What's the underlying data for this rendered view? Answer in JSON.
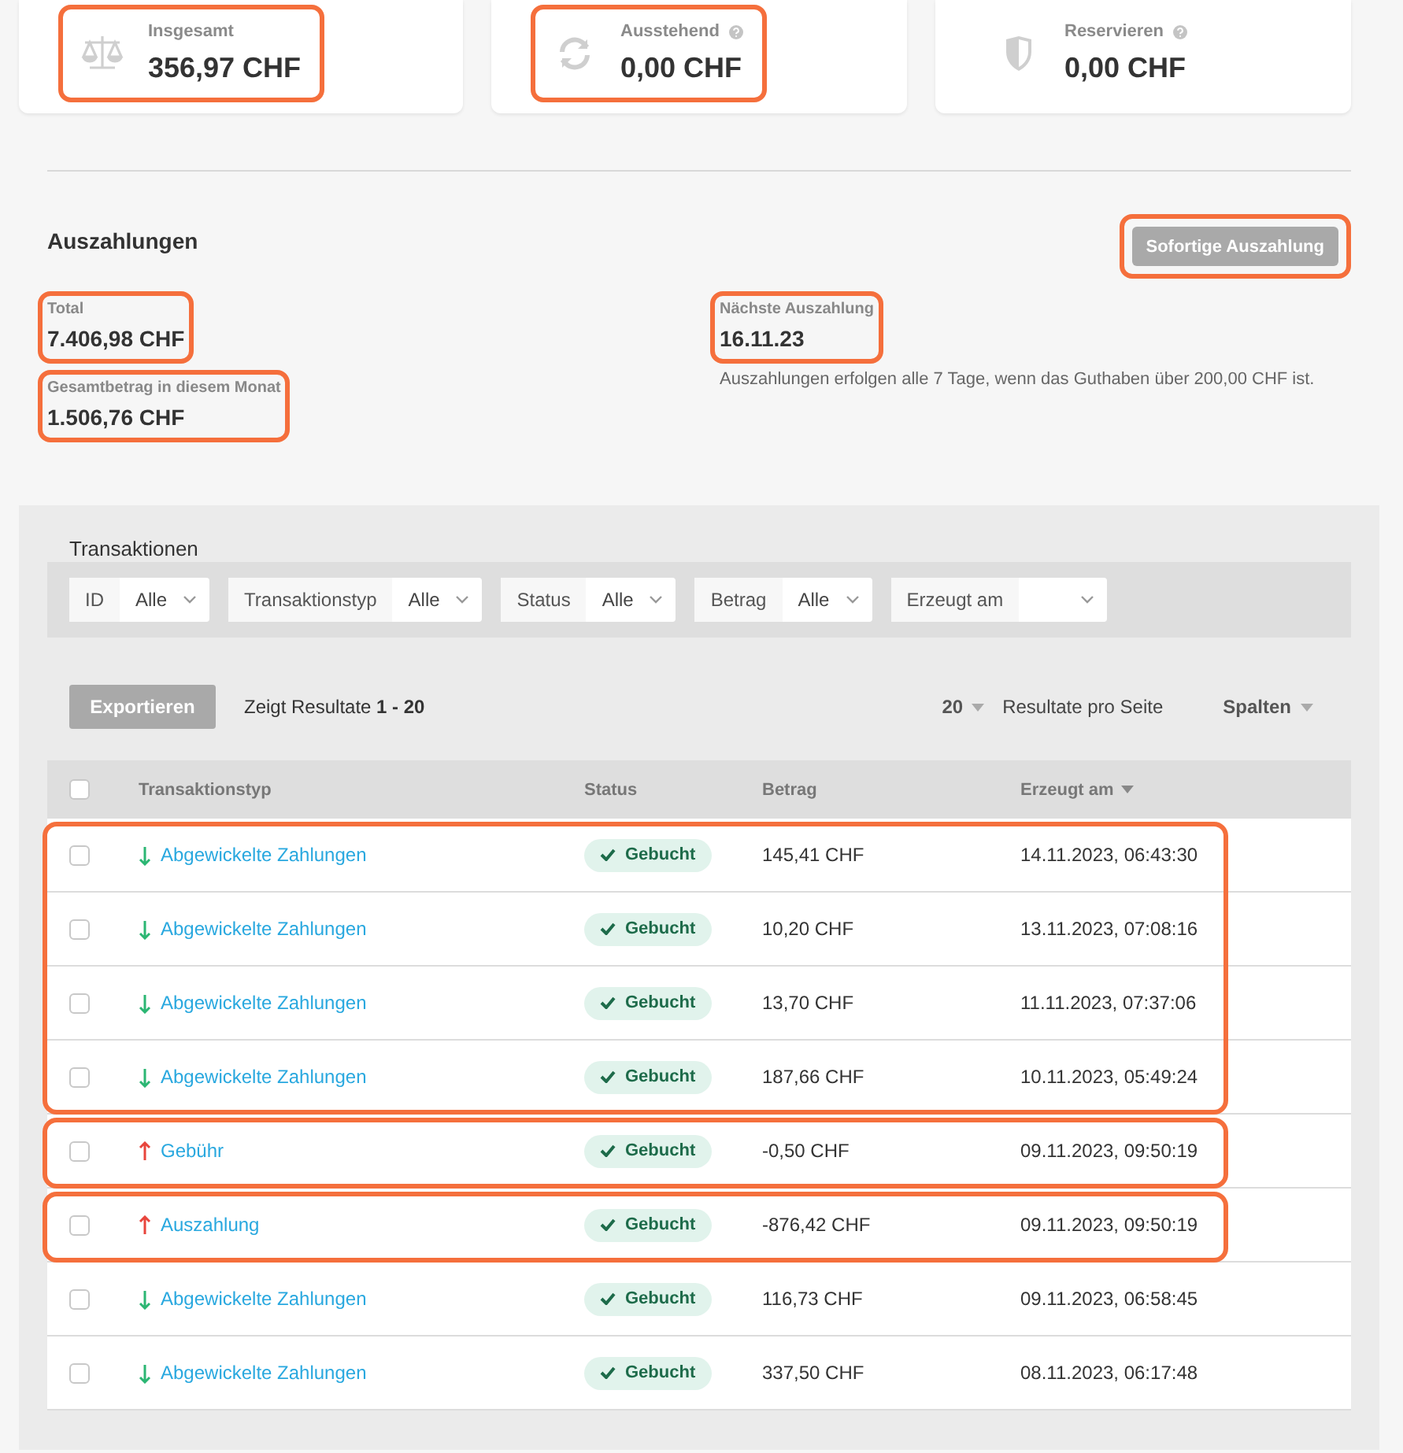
{
  "summary_cards": [
    {
      "kind": "scale",
      "label": "Insgesamt",
      "help": false,
      "value": "356,97 CHF",
      "highlighted": true
    },
    {
      "kind": "refresh",
      "label": "Ausstehend",
      "help": true,
      "value": "0,00 CHF",
      "highlighted": true
    },
    {
      "kind": "shield",
      "label": "Reservieren",
      "help": true,
      "value": "0,00 CHF",
      "highlighted": false
    }
  ],
  "payouts": {
    "title": "Auszahlungen",
    "button": {
      "label": "Sofortige Auszahlung",
      "highlighted": true
    },
    "left_stats": [
      {
        "label": "Total",
        "value": "7.406,98 CHF",
        "highlighted": true
      },
      {
        "label": "Gesamtbetrag in diesem Monat",
        "value": "1.506,76 CHF",
        "highlighted": true
      }
    ],
    "right_stats": [
      {
        "label": "Nächste Auszahlung",
        "value": "16.11.23",
        "highlighted": true
      }
    ],
    "note": "Auszahlungen erfolgen alle 7 Tage, wenn das Guthaben über 200,00 CHF ist."
  },
  "transactions": {
    "title": "Transaktionen",
    "filters": [
      {
        "label": "ID",
        "value": "Alle"
      },
      {
        "label": "Transaktionstyp",
        "value": "Alle"
      },
      {
        "label": "Status",
        "value": "Alle"
      },
      {
        "label": "Betrag",
        "value": "Alle"
      },
      {
        "label": "Erzeugt am"
      }
    ],
    "export_button": "Exportieren",
    "results_text": "Zeigt Resultate **1 - 20**",
    "page_size": "20",
    "page_size_label": "Resultate pro Seite",
    "columns_button": "Spalten",
    "table": {
      "select_all_checked": false,
      "columns": [
        {
          "label": "Transaktionstyp",
          "sorted": false
        },
        {
          "label": "Status",
          "sorted": false
        },
        {
          "label": "Betrag",
          "sorted": false
        },
        {
          "label": "Erzeugt am",
          "sorted": true
        }
      ],
      "row_groups": [
        {
          "highlighted": true,
          "rows": [
            {
              "checked": false,
              "kind": "in",
              "type": "Abgewickelte Zahlungen",
              "status": "Gebucht",
              "amount": "145,41 CHF",
              "created": "14.11.2023, 06:43:30"
            },
            {
              "checked": false,
              "kind": "in",
              "type": "Abgewickelte Zahlungen",
              "status": "Gebucht",
              "amount": "10,20 CHF",
              "created": "13.11.2023, 07:08:16"
            },
            {
              "checked": false,
              "kind": "in",
              "type": "Abgewickelte Zahlungen",
              "status": "Gebucht",
              "amount": "13,70 CHF",
              "created": "11.11.2023, 07:37:06"
            },
            {
              "checked": false,
              "kind": "in",
              "type": "Abgewickelte Zahlungen",
              "status": "Gebucht",
              "amount": "187,66 CHF",
              "created": "10.11.2023, 05:49:24"
            }
          ]
        },
        {
          "highlighted": true,
          "rows": [
            {
              "checked": false,
              "kind": "out",
              "type": "Gebühr",
              "status": "Gebucht",
              "amount": "-0,50 CHF",
              "created": "09.11.2023, 09:50:19"
            }
          ]
        },
        {
          "highlighted": true,
          "rows": [
            {
              "checked": false,
              "kind": "out",
              "type": "Auszahlung",
              "status": "Gebucht",
              "amount": "-876,42 CHF",
              "created": "09.11.2023, 09:50:19"
            }
          ]
        },
        {
          "highlighted": false,
          "rows": [
            {
              "checked": false,
              "kind": "in",
              "type": "Abgewickelte Zahlungen",
              "status": "Gebucht",
              "amount": "116,73 CHF",
              "created": "09.11.2023, 06:58:45"
            },
            {
              "checked": false,
              "kind": "in",
              "type": "Abgewickelte Zahlungen",
              "status": "Gebucht",
              "amount": "337,50 CHF",
              "created": "08.11.2023, 06:17:48"
            }
          ]
        }
      ]
    }
  }
}
